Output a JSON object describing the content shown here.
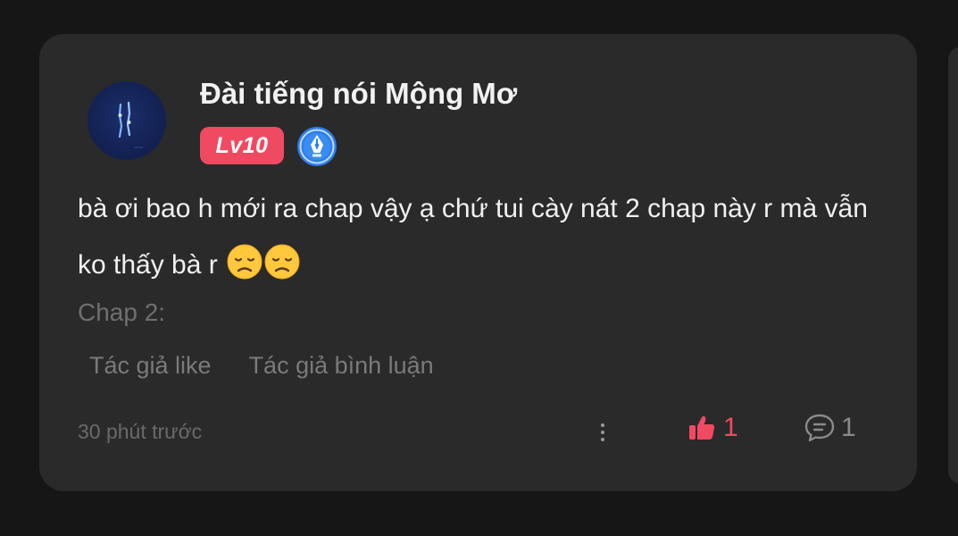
{
  "comment": {
    "username": "Đài tiếng nói Mộng Mơ",
    "level_badge": "Lv10",
    "text": "bà ơi bao h mới ra chap vậy ạ chứ tui cày nát 2 chap này r mà vẫn ko thấy bà r",
    "emojis": [
      "disappointed-face",
      "disappointed-face"
    ],
    "chapter_label": "Chap 2:",
    "tags": [
      "Tác giả like",
      "Tác giả bình luận"
    ],
    "timestamp": "30 phút trước",
    "like_count": "1",
    "reply_count": "1"
  },
  "icons": {
    "like": "thumbs-up-icon",
    "reply": "comment-icon",
    "more": "more-vertical-icon",
    "pen_badge": "pen-nib-badge-icon"
  },
  "colors": {
    "background": "#161616",
    "card": "#2a2a2a",
    "accent_red": "#f04a62",
    "badge_blue": "#2f7de8",
    "text_primary": "#f0f0f0",
    "text_muted": "#6f6f6f"
  }
}
